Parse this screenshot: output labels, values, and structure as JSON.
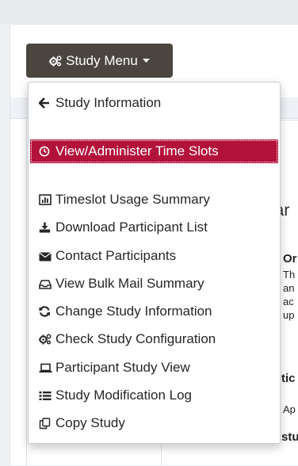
{
  "study_menu": {
    "label": "Study Menu",
    "icon": "gears-icon",
    "items": [
      {
        "label": "Study Information",
        "icon": "arrow-left-icon",
        "active": false
      },
      {
        "label": "View/Administer Time Slots",
        "icon": "clock-icon",
        "active": true
      },
      {
        "label": "Timeslot Usage Summary",
        "icon": "bar-chart-icon",
        "active": false
      },
      {
        "label": "Download Participant List",
        "icon": "download-icon",
        "active": false
      },
      {
        "label": "Contact Participants",
        "icon": "envelope-icon",
        "active": false
      },
      {
        "label": "View Bulk Mail Summary",
        "icon": "inbox-icon",
        "active": false
      },
      {
        "label": "Change Study Information",
        "icon": "refresh-icon",
        "active": false
      },
      {
        "label": "Check Study Configuration",
        "icon": "gears-icon",
        "active": false
      },
      {
        "label": "Participant Study View",
        "icon": "laptop-icon",
        "active": false
      },
      {
        "label": "Study Modification Log",
        "icon": "list-icon",
        "active": false
      },
      {
        "label": "Copy Study",
        "icon": "copy-icon",
        "active": false
      }
    ]
  },
  "background": {
    "fragments": [
      "lar",
      "Or",
      "Th",
      "an",
      "ac",
      "up",
      "tic",
      "Ap",
      "stu"
    ]
  },
  "colors": {
    "button_bg": "#4b4540",
    "active_item_bg": "#b3123a",
    "page_bg": "#eef0f3"
  }
}
